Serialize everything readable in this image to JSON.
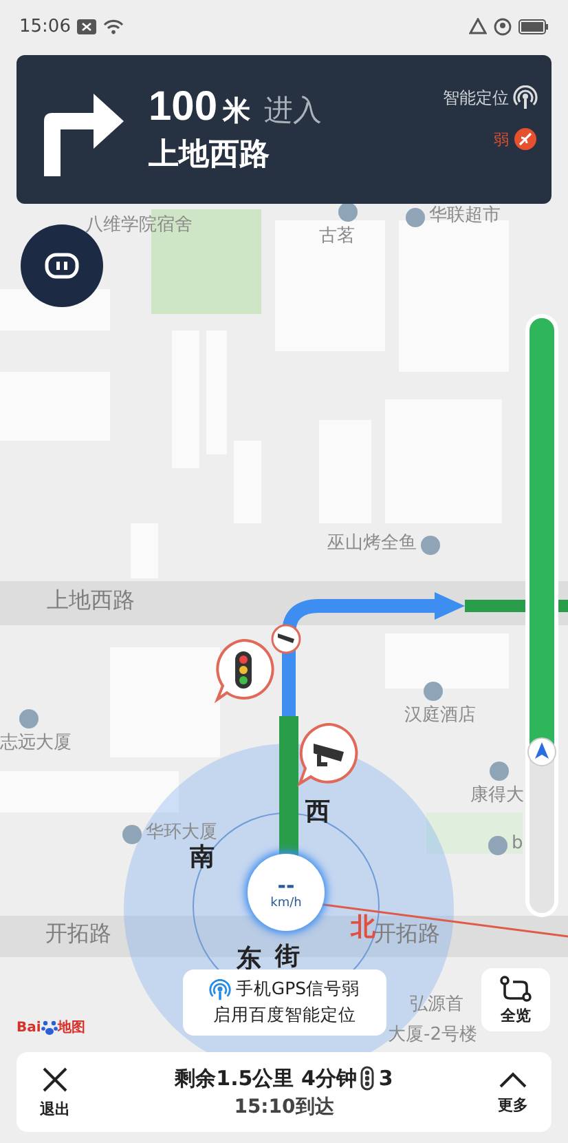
{
  "status_bar": {
    "time": "15:06"
  },
  "guidance": {
    "distance": "100",
    "unit": "米",
    "action": "进入",
    "road": "上地西路",
    "positioning": "智能定位",
    "signal": "弱"
  },
  "map": {
    "labels": [
      {
        "text": "八维学院宿舍",
        "kind": "poi_plain"
      },
      {
        "text": "古茗",
        "kind": "poi"
      },
      {
        "text": "华联超市",
        "kind": "poi"
      },
      {
        "text": "巫山烤全鱼",
        "kind": "poi"
      },
      {
        "text": "上地西路",
        "kind": "road"
      },
      {
        "text": "汉庭酒店",
        "kind": "poi"
      },
      {
        "text": "志远大厦",
        "kind": "poi"
      },
      {
        "text": "康得大",
        "kind": "poi"
      },
      {
        "text": "华环大厦",
        "kind": "poi"
      },
      {
        "text": "b",
        "kind": "poi"
      },
      {
        "text": "开拓路",
        "kind": "road"
      },
      {
        "text": "西",
        "kind": "compass"
      },
      {
        "text": "南",
        "kind": "compass"
      },
      {
        "text": "街",
        "kind": "compass"
      },
      {
        "text": "北",
        "kind": "north"
      },
      {
        "text": "开拓路",
        "kind": "road"
      },
      {
        "text": "东",
        "kind": "compass"
      },
      {
        "text": "弘源首",
        "kind": "poi_plain"
      },
      {
        "text": "大厦-2号楼",
        "kind": "poi_plain"
      }
    ]
  },
  "speed": {
    "value": "--",
    "unit": "km/h"
  },
  "route_progress": {
    "level": 0.73
  },
  "gps_notice": {
    "title": "手机GPS信号弱",
    "subtitle": "启用百度智能定位"
  },
  "overview_button": {
    "label": "全览"
  },
  "logo": {
    "text": "Bai",
    "suffix": "地图"
  },
  "trip": {
    "exit": "退出",
    "remaining": "剩余1.5公里 4分钟",
    "lights": "3",
    "arrival": "15:10到达",
    "more": "更多"
  }
}
